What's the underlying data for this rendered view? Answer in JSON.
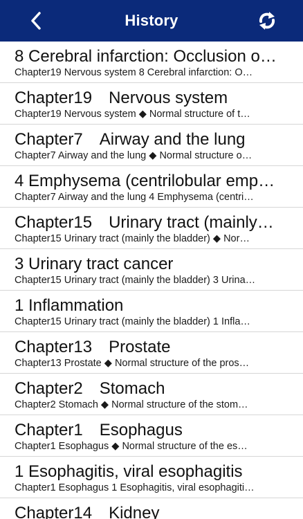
{
  "header": {
    "title": "History",
    "back_icon": "chevron-left-icon",
    "refresh_icon": "refresh-icon",
    "background_color": "#0b2a7a"
  },
  "history": [
    {
      "title": "8 Cerebral infarction: Occlusion o…",
      "subtitle": "Chapter19 Nervous system 8 Cerebral infarction: O…"
    },
    {
      "title": "Chapter19　Nervous system",
      "subtitle": "Chapter19 Nervous system ◆ Normal structure of t…"
    },
    {
      "title": "Chapter7　Airway and the lung",
      "subtitle": "Chapter7 Airway and the lung ◆ Normal structure o…"
    },
    {
      "title": "4 Emphysema (centrilobular emp…",
      "subtitle": "Chapter7 Airway and the lung 4 Emphysema (centri…"
    },
    {
      "title": "Chapter15　Urinary tract (mainly…",
      "subtitle": "Chapter15 Urinary tract (mainly the bladder) ◆ Nor…"
    },
    {
      "title": "3 Urinary tract cancer",
      "subtitle": "Chapter15 Urinary tract (mainly the bladder) 3 Urina…"
    },
    {
      "title": "1 Inflammation",
      "subtitle": "Chapter15 Urinary tract (mainly the bladder) 1 Infla…"
    },
    {
      "title": "Chapter13　Prostate",
      "subtitle": "Chapter13 Prostate ◆ Normal structure of the pros…"
    },
    {
      "title": "Chapter2　Stomach",
      "subtitle": "Chapter2 Stomach ◆ Normal structure of the stom…"
    },
    {
      "title": "Chapter1　Esophagus",
      "subtitle": "Chapter1 Esophagus ◆ Normal structure of the es…"
    },
    {
      "title": "1 Esophagitis, viral esophagitis",
      "subtitle": "Chapter1 Esophagus 1 Esophagitis, viral esophagiti…"
    },
    {
      "title": "Chapter14　Kidney",
      "subtitle": ""
    }
  ]
}
